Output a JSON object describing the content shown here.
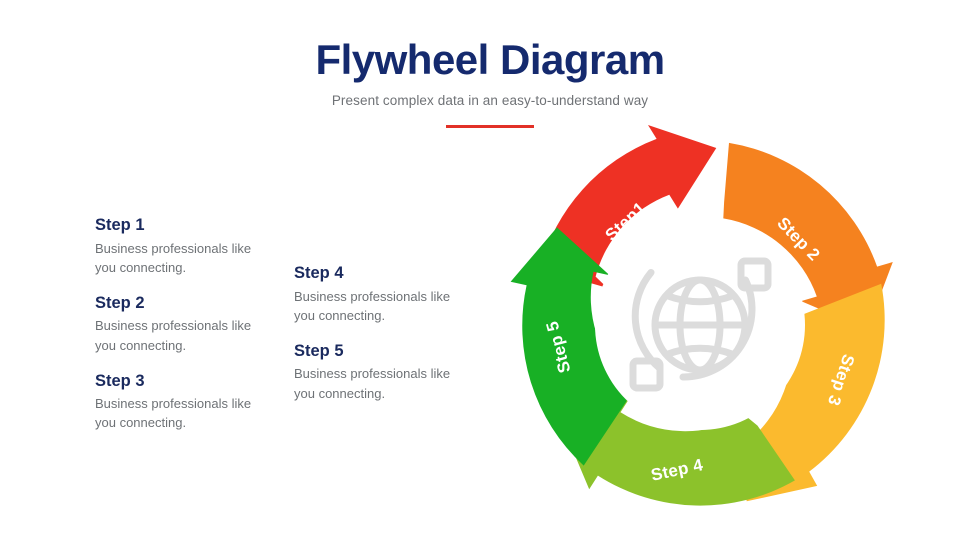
{
  "header": {
    "title": "Flywheel Diagram",
    "subtitle": "Present complex data in an easy-to-understand way",
    "rule_color": "#e23127",
    "title_color": "#152a6e",
    "subtitle_color": "#6f7276"
  },
  "text_columns": [
    {
      "id": "column-left",
      "steps": [
        {
          "heading": "Step 1",
          "body": "Business professionals like you connecting."
        },
        {
          "heading": "Step 2",
          "body": "Business professionals like you connecting."
        },
        {
          "heading": "Step 3",
          "body": "Business professionals like you connecting."
        }
      ]
    },
    {
      "id": "column-middle",
      "steps": [
        {
          "heading": "Step 4",
          "body": "Business professionals like you connecting."
        },
        {
          "heading": "Step 5",
          "body": "Business professionals like you connecting."
        }
      ]
    }
  ],
  "diagram": {
    "type": "flywheel",
    "direction": "clockwise",
    "center_icon": "globe-network-icon",
    "center_icon_color": "#dcdcdc",
    "hub_color": "#ffffff",
    "segment_count": 5,
    "segments": [
      {
        "label": "Step1",
        "color": "#ee3124",
        "name": "segment-step-1"
      },
      {
        "label": "Step 2",
        "color": "#f5821f",
        "name": "segment-step-2"
      },
      {
        "label": "Step 3",
        "color": "#fbba2e",
        "name": "segment-step-3"
      },
      {
        "label": "Step 4",
        "color": "#8cc22b",
        "name": "segment-step-4"
      },
      {
        "label": "Step 5",
        "color": "#18b025",
        "name": "segment-step-5"
      }
    ]
  }
}
